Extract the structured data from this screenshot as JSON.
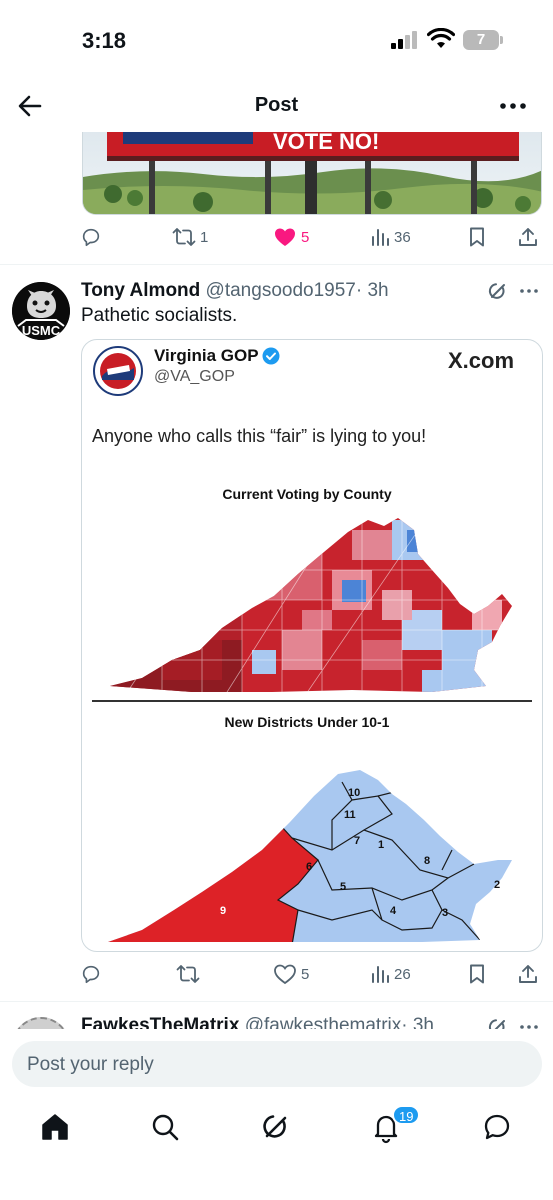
{
  "status_bar": {
    "time": "3:18",
    "battery": "7"
  },
  "nav": {
    "title": "Post",
    "back_icon": "arrow-left-icon",
    "more_icon": "more-dots-icon"
  },
  "top_post": {
    "image_text": "VOTE NO!",
    "actions": {
      "reply_count": "",
      "repost_count": "1",
      "like_count": "5",
      "view_count": "36",
      "liked": true
    }
  },
  "reply_post": {
    "author_name": "Tony Almond",
    "author_handle": "@tangsoodo1957",
    "timestamp": "· 3h",
    "text": "Pathetic socialists.",
    "avatar_text": "USMC",
    "embedded": {
      "name": "Virginia GOP",
      "handle": "@VA_GOP",
      "xcom": "X.com",
      "quote": "Anyone who calls this “fair” is lying to you!",
      "map1_title": "Current Voting by County",
      "map2_title": "New Districts Under 10-1",
      "district_labels": [
        "10",
        "11",
        "7",
        "1",
        "6",
        "8",
        "5",
        "2",
        "9",
        "4",
        "3"
      ]
    },
    "actions": {
      "reply_count": "",
      "repost_count": "",
      "like_count": "5",
      "view_count": "26"
    }
  },
  "next_post": {
    "author_name": "FawkesTheMatrix",
    "author_handle": "@fawkesthematrix",
    "timestamp": "· 3h"
  },
  "reply_bar": {
    "placeholder": "Post your reply"
  },
  "tab_bar": {
    "notification_badge": "19"
  },
  "colors": {
    "like": "#f91880",
    "accent": "#1d9bf0",
    "text": "#0f1419",
    "secondary": "#536471",
    "red_party": "#d7191c",
    "blue_party": "#a9c8f0"
  }
}
